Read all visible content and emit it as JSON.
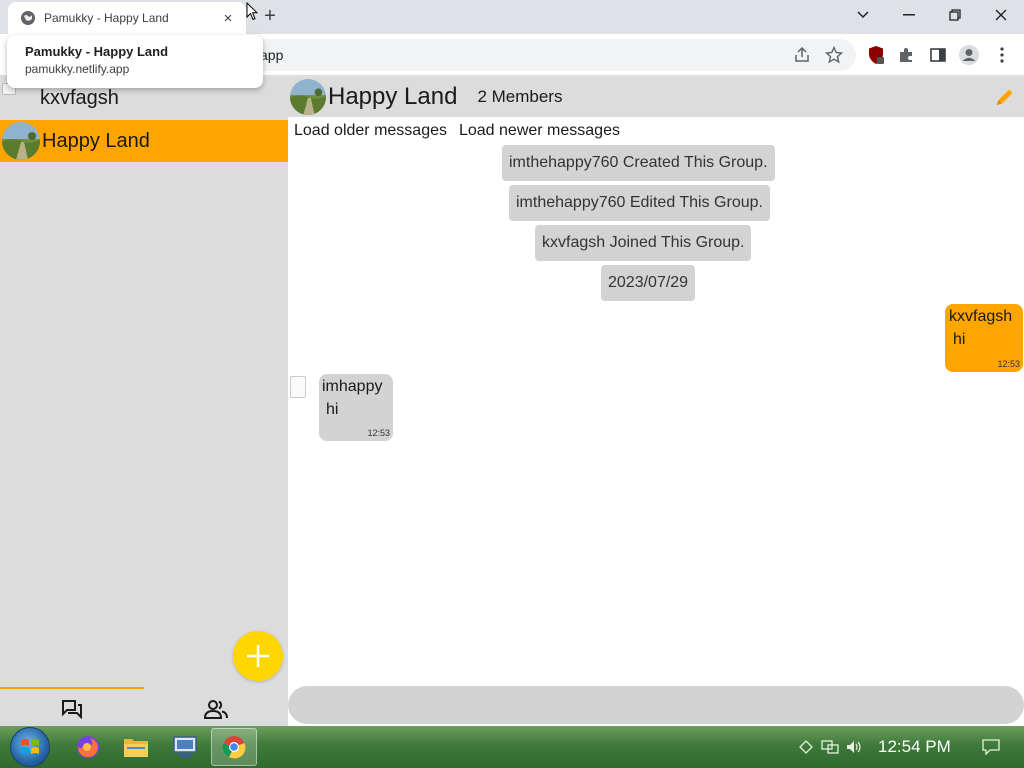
{
  "browser": {
    "tab_title": "Pamukky - Happy Land",
    "tab_close": "×",
    "new_tab": "+",
    "url_suffix": "app",
    "hovercard": {
      "title": "Pamukky - Happy Land",
      "url": "pamukky.netlify.app"
    }
  },
  "sidebar": {
    "user_name": "kxvfagsh",
    "chats": [
      {
        "name": "Happy Land",
        "selected": true
      }
    ],
    "tabs": [
      {
        "icon": "chats-icon"
      },
      {
        "icon": "people-icon"
      }
    ]
  },
  "chat": {
    "name": "Happy Land",
    "members": "2 Members",
    "load_older": "Load older messages",
    "load_newer": "Load newer messages",
    "system_messages": [
      "imthehappy760 Created This Group.",
      "imthehappy760 Edited This Group.",
      "kxvfagsh Joined This Group.",
      "2023/07/29"
    ],
    "messages": [
      {
        "sender": "kxvfagsh",
        "text": "hi",
        "time": "12:53",
        "mine": true
      },
      {
        "sender": "imhappy",
        "text": "hi",
        "time": "12:53",
        "mine": false
      }
    ],
    "composer_placeholder": ""
  },
  "taskbar": {
    "apps": [
      "firefox",
      "file-explorer",
      "network-tool",
      "chrome"
    ],
    "clock": "12:54 PM"
  },
  "colors": {
    "accent": "#ffa500",
    "fab": "#ffd600",
    "panel": "#dcdcdc",
    "bubble_other": "#d3d3d3"
  }
}
